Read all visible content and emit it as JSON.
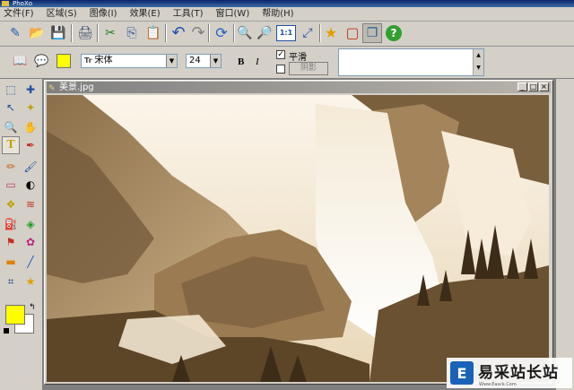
{
  "app": {
    "title": "PhoXo"
  },
  "menubar": {
    "items": [
      "文件(F)",
      "区域(S)",
      "图像(I)",
      "效果(E)",
      "工具(T)",
      "窗口(W)",
      "帮助(H)"
    ]
  },
  "toolbar": {
    "buttons": [
      {
        "name": "new-icon",
        "glyph": "✎"
      },
      {
        "name": "open-icon",
        "glyph": "📂"
      },
      {
        "name": "save-icon",
        "glyph": "💾"
      },
      {
        "name": "scan-icon",
        "glyph": "🖨"
      },
      {
        "name": "cut-icon",
        "glyph": "✂"
      },
      {
        "name": "copy-icon",
        "glyph": "⎘"
      },
      {
        "name": "paste-icon",
        "glyph": "📋"
      },
      {
        "name": "undo-icon",
        "glyph": "↶"
      },
      {
        "name": "redo-icon",
        "glyph": "↷"
      },
      {
        "name": "refresh-icon",
        "glyph": "⟳"
      },
      {
        "name": "zoom-in-icon",
        "glyph": "🔍"
      },
      {
        "name": "zoom-out-icon",
        "glyph": "🔎"
      },
      {
        "name": "actual-size-icon",
        "glyph": "1:1"
      },
      {
        "name": "fit-window-icon",
        "glyph": "⤢"
      },
      {
        "name": "favorite-icon",
        "glyph": "★"
      },
      {
        "name": "frame-icon",
        "glyph": "▢"
      },
      {
        "name": "layers-icon",
        "glyph": "❐"
      },
      {
        "name": "help-icon",
        "glyph": "?"
      }
    ]
  },
  "textbar": {
    "book_icon": "📖",
    "bubble_icon": "💬",
    "text_color": "#ffff00",
    "font_tag": "Tr",
    "font_name": "宋体",
    "font_size": "24",
    "bold": "B",
    "italic": "I",
    "smooth_checked": "✓",
    "smooth_label": "平滑",
    "shadow_checked": "",
    "shadow_label": "阴影"
  },
  "tools": {
    "fg_color": "#ffff00",
    "bg_color": "#ffffff",
    "swap_icon": "↰",
    "items": [
      {
        "name": "rect-select-icon",
        "glyph": "⬚"
      },
      {
        "name": "move-icon",
        "glyph": "✚"
      },
      {
        "name": "lasso-icon",
        "glyph": "↖"
      },
      {
        "name": "magic-wand-icon",
        "glyph": "✦"
      },
      {
        "name": "zoom-tool-icon",
        "glyph": "🔍"
      },
      {
        "name": "hand-icon",
        "glyph": "✋"
      },
      {
        "name": "text-tool-icon",
        "glyph": "T"
      },
      {
        "name": "eyedropper-icon",
        "glyph": "✒"
      },
      {
        "name": "pencil-icon",
        "glyph": "✏"
      },
      {
        "name": "brush-icon",
        "glyph": "🖌"
      },
      {
        "name": "eraser-icon",
        "glyph": "▭"
      },
      {
        "name": "contrast-icon",
        "glyph": "◐"
      },
      {
        "name": "clone-icon",
        "glyph": "❖"
      },
      {
        "name": "smudge-icon",
        "glyph": "≋"
      },
      {
        "name": "fill-icon",
        "glyph": "⛽"
      },
      {
        "name": "color-replace-icon",
        "glyph": "◈"
      },
      {
        "name": "stamp-icon",
        "glyph": "⚑"
      },
      {
        "name": "sponge-icon",
        "glyph": "✿"
      },
      {
        "name": "gradient-icon",
        "glyph": "▬"
      },
      {
        "name": "line-icon",
        "glyph": "╱"
      },
      {
        "name": "crop-icon",
        "glyph": "⌗"
      },
      {
        "name": "shape-icon",
        "glyph": "★"
      }
    ]
  },
  "image_window": {
    "title": "美景.jpg",
    "min_glyph": "_",
    "max_glyph": "□",
    "close_glyph": "×"
  },
  "watermark": {
    "logo_glyph": "E",
    "text": "易采站长站",
    "subtext": "Www.Easck.Com"
  }
}
